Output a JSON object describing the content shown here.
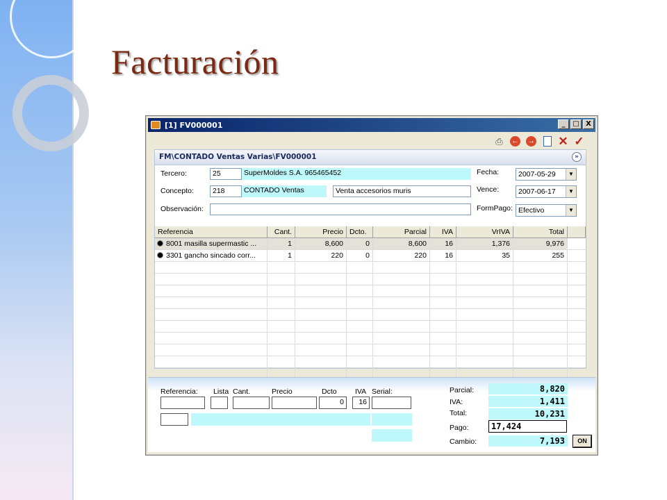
{
  "slide": {
    "title": "Facturación"
  },
  "window": {
    "title": "[1] FV000001",
    "controls": [
      "_",
      "□",
      "X"
    ]
  },
  "toolbar": {
    "icons": [
      "printer-icon",
      "back-icon",
      "forward-icon",
      "document-icon",
      "cancel-icon",
      "confirm-icon"
    ]
  },
  "header": {
    "path": "FM\\CONTADO Ventas Varias\\FV000001",
    "tercero_label": "Tercero:",
    "tercero_code": "25",
    "tercero_name": "SuperMoldes S.A. 965465452",
    "concepto_label": "Concepto:",
    "concepto_code": "218",
    "concepto_name": "CONTADO Ventas",
    "concepto_desc": "Venta accesorios muris",
    "observacion_label": "Observación:",
    "observacion_value": "",
    "fecha_label": "Fecha:",
    "fecha_value": "2007-05-29",
    "vence_label": "Vence:",
    "vence_value": "2007-06-17",
    "formpago_label": "FormPago:",
    "formpago_value": "Efectivo"
  },
  "grid": {
    "columns": [
      "Referencia",
      "Cant.",
      "Precio",
      "Dcto.",
      "Parcial",
      "IVA",
      "VrIVA",
      "Total"
    ],
    "rows": [
      {
        "ref": "8001 masilla supermastic ...",
        "cant": "1",
        "precio": "8,600",
        "dcto": "0",
        "parcial": "8,600",
        "iva": "16",
        "vriva": "1,376",
        "total": "9,976"
      },
      {
        "ref": "3301 gancho sincado corr...",
        "cant": "1",
        "precio": "220",
        "dcto": "0",
        "parcial": "220",
        "iva": "16",
        "vriva": "35",
        "total": "255"
      }
    ]
  },
  "entry": {
    "referencia_label": "Referencia:",
    "lista_label": "Lista",
    "cant_label": "Cant.",
    "precio_label": "Precio",
    "dcto_label": "Dcto",
    "iva_label": "IVA",
    "serial_label": "Serial:",
    "dcto_value": "0",
    "iva_value": "16"
  },
  "totals": {
    "parcial_label": "Parcial:",
    "parcial_value": "8,820",
    "iva_label": "IVA:",
    "iva_value": "1,411",
    "total_label": "Total:",
    "total_value": "10,231",
    "pago_label": "Pago:",
    "pago_value": "17,424",
    "cambio_label": "Cambio:",
    "cambio_value": "7,193",
    "ok_label": "ON"
  },
  "colors": {
    "title": "#7a2a12",
    "cyan": "#bff8fb",
    "titlebar": "#0a246a"
  }
}
